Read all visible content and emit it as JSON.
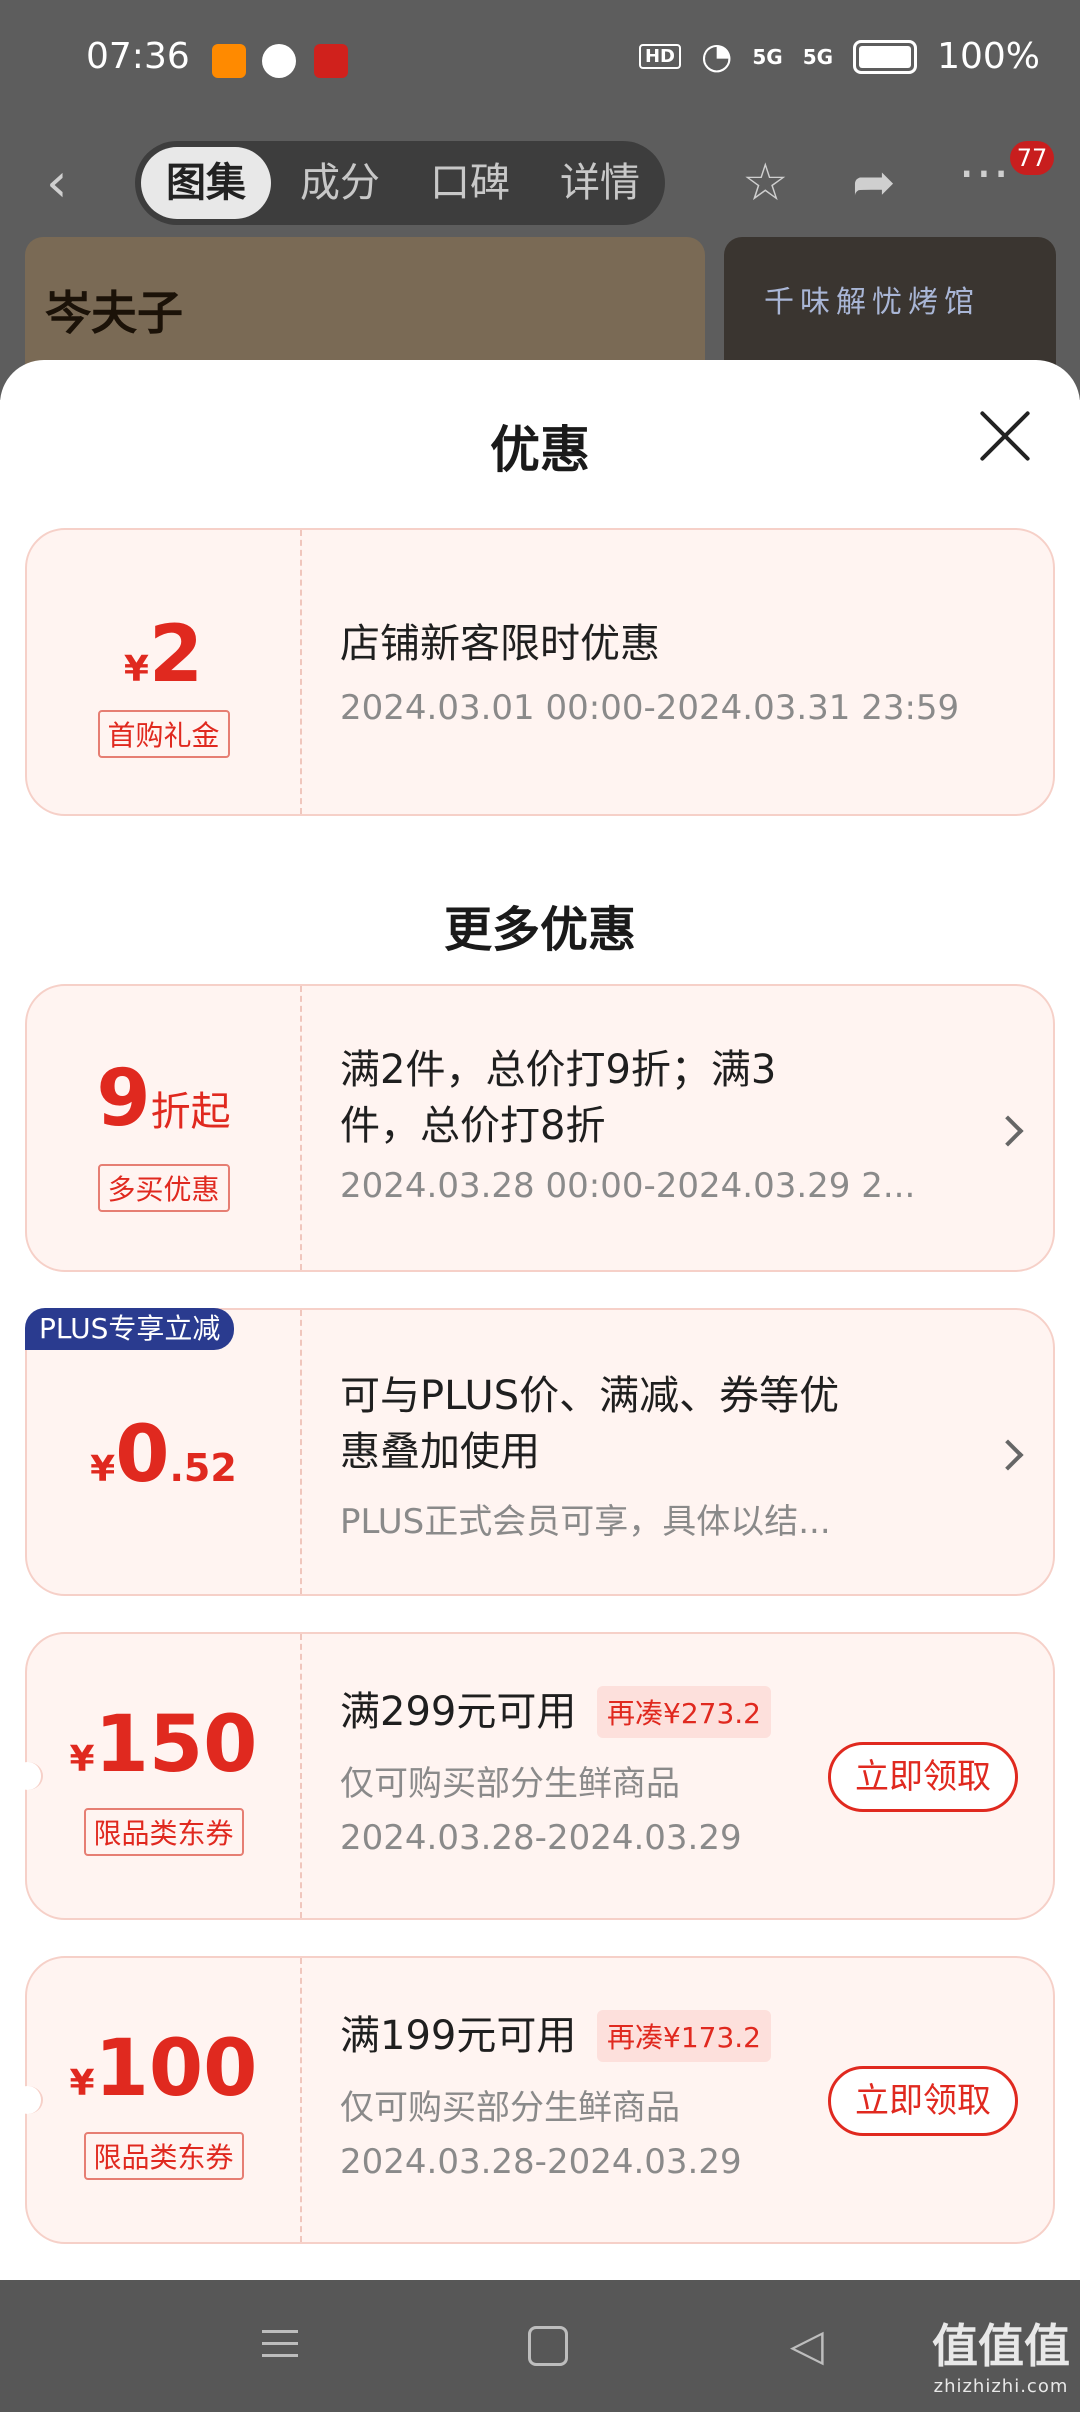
{
  "status_bar": {
    "time": "07:36",
    "network_badge": "HD",
    "signal_1": "5G",
    "signal_2": "5G",
    "battery": "100%"
  },
  "nav": {
    "tabs": [
      {
        "label": "图集",
        "active": true
      },
      {
        "label": "成分",
        "active": false
      },
      {
        "label": "口碑",
        "active": false
      },
      {
        "label": "详情",
        "active": false
      }
    ],
    "more_badge": "77"
  },
  "background_images": {
    "thumb1_text": "岑夫子",
    "thumb2_text": "千味解忧烤馆"
  },
  "sheet": {
    "title": "优惠",
    "new_customer": {
      "currency": "¥",
      "amount": "2",
      "tag": "首购礼金",
      "title": "店铺新客限时优惠",
      "period": "2024.03.01 00:00-2024.03.31 23:59"
    },
    "more_title": "更多优惠",
    "multi_buy": {
      "amount": "9",
      "suffix": "折起",
      "tag": "多买优惠",
      "title_line1": "满2件，总价打9折；满3",
      "title_line2": "件，总价打8折",
      "period": "2024.03.28 00:00-2024.03.29 2..."
    },
    "plus": {
      "badge": "PLUS专享立减",
      "currency": "¥",
      "amount_int": "0",
      "amount_dec": ".52",
      "title_line1": "可与PLUS价、满减、券等优",
      "title_line2": "惠叠加使用",
      "desc": "PLUS正式会员可享，具体以结..."
    },
    "coupons": [
      {
        "currency": "¥",
        "amount": "150",
        "tag": "限品类东券",
        "condition": "满299元可用",
        "again": "再凑¥273.2",
        "scope": "仅可购买部分生鲜商品",
        "period": "2024.03.28-2024.03.29",
        "button": "立即领取"
      },
      {
        "currency": "¥",
        "amount": "100",
        "tag": "限品类东券",
        "condition": "满199元可用",
        "again": "再凑¥173.2",
        "scope": "仅可购买部分生鲜商品",
        "period": "2024.03.28-2024.03.29",
        "button": "立即领取"
      }
    ]
  },
  "watermark": {
    "main": "值值值",
    "sub": "zhizhizhi.com"
  },
  "colors": {
    "accent_red": "#e0291f",
    "card_bg": "#fff4f1",
    "plus_blue": "#2a3b8f"
  }
}
